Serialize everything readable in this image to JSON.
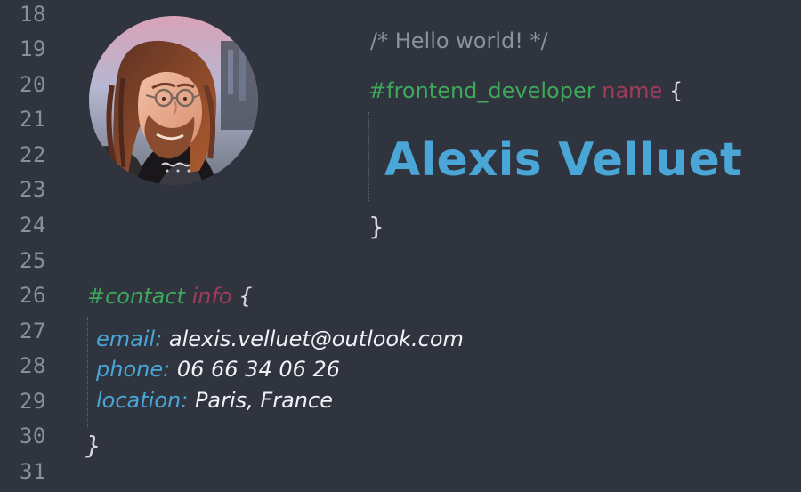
{
  "line_numbers": [
    "18",
    "19",
    "20",
    "21",
    "22",
    "23",
    "24",
    "25",
    "26",
    "27",
    "28",
    "29",
    "30",
    "31"
  ],
  "header": {
    "comment": "/* Hello world! */",
    "selector_id": "#frontend_developer",
    "selector_tag": "name",
    "open_brace": "{",
    "name": "Alexis Velluet",
    "close_brace": "}"
  },
  "contact": {
    "selector_id": "#contact",
    "selector_tag": "info",
    "open_brace": "{",
    "close_brace": "}",
    "rows": [
      {
        "key": "email:",
        "value": "alexis.velluet@outlook.com"
      },
      {
        "key": "phone:",
        "value": "06 66 34 06 26"
      },
      {
        "key": "location:",
        "value": "Paris, France"
      }
    ]
  },
  "colors": {
    "background": "#2f343e",
    "line_number": "#8b9098",
    "comment": "#8c929c",
    "selector_id": "#3ea85a",
    "selector_tag": "#a23b5a",
    "name": "#4aa6d6",
    "contact_key": "#4aa6d6",
    "contact_value": "#eef1f5"
  },
  "icons": {
    "avatar": "profile-photo"
  }
}
